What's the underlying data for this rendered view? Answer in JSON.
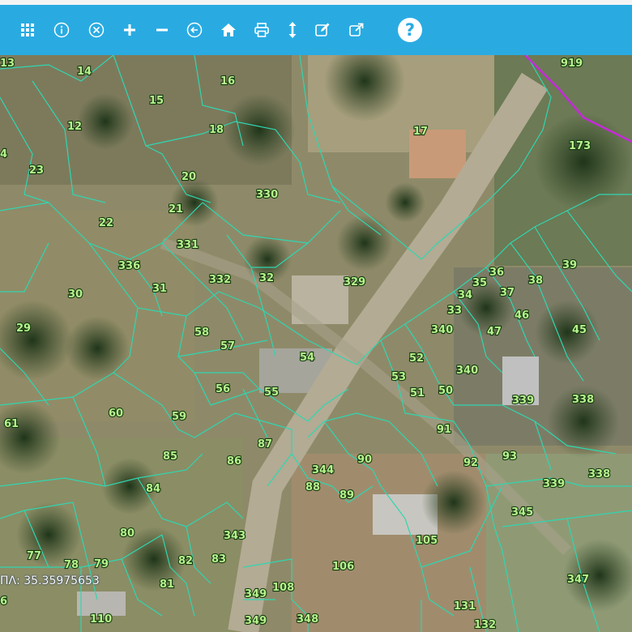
{
  "toolbar": {
    "buttons": [
      {
        "name": "grid-menu-button",
        "icon": "grid-icon"
      },
      {
        "name": "info-button",
        "icon": "info-icon"
      },
      {
        "name": "clear-button",
        "icon": "circle-close-icon"
      },
      {
        "name": "zoom-in-button",
        "icon": "plus-icon"
      },
      {
        "name": "zoom-out-button",
        "icon": "minus-icon"
      },
      {
        "name": "back-button",
        "icon": "circle-arrow-left-icon"
      },
      {
        "name": "home-button",
        "icon": "home-icon"
      },
      {
        "name": "print-button",
        "icon": "printer-icon"
      },
      {
        "name": "measure-button",
        "icon": "vertical-arrows-icon"
      },
      {
        "name": "edit-button",
        "icon": "edit-icon"
      },
      {
        "name": "open-external-button",
        "icon": "external-link-icon"
      },
      {
        "name": "help-button",
        "icon": "question-icon"
      }
    ],
    "color": "#29abe2"
  },
  "map": {
    "parcel_line_color": "#2fd6b0",
    "boundary_color": "#c42bd8",
    "label_color": "#b7f28d",
    "parcels": [
      {
        "label": "13"
      },
      {
        "label": "14"
      },
      {
        "label": "16"
      },
      {
        "label": "15"
      },
      {
        "label": "12"
      },
      {
        "label": "18"
      },
      {
        "label": "17"
      },
      {
        "label": "919"
      },
      {
        "label": "173"
      },
      {
        "label": "4"
      },
      {
        "label": "23"
      },
      {
        "label": "20"
      },
      {
        "label": "330"
      },
      {
        "label": "21"
      },
      {
        "label": "22"
      },
      {
        "label": "331"
      },
      {
        "label": "336"
      },
      {
        "label": "332"
      },
      {
        "label": "32"
      },
      {
        "label": "329"
      },
      {
        "label": "31"
      },
      {
        "label": "30"
      },
      {
        "label": "36"
      },
      {
        "label": "39"
      },
      {
        "label": "35"
      },
      {
        "label": "38"
      },
      {
        "label": "34"
      },
      {
        "label": "37"
      },
      {
        "label": "33"
      },
      {
        "label": "46"
      },
      {
        "label": "29"
      },
      {
        "label": "58"
      },
      {
        "label": "340"
      },
      {
        "label": "47"
      },
      {
        "label": "45"
      },
      {
        "label": "57"
      },
      {
        "label": "54"
      },
      {
        "label": "52"
      },
      {
        "label": "340"
      },
      {
        "label": "53"
      },
      {
        "label": "56"
      },
      {
        "label": "55"
      },
      {
        "label": "51"
      },
      {
        "label": "50"
      },
      {
        "label": "339"
      },
      {
        "label": "338"
      },
      {
        "label": "60"
      },
      {
        "label": "59"
      },
      {
        "label": "61"
      },
      {
        "label": "91"
      },
      {
        "label": "87"
      },
      {
        "label": "85"
      },
      {
        "label": "86"
      },
      {
        "label": "90"
      },
      {
        "label": "93"
      },
      {
        "label": "92"
      },
      {
        "label": "344"
      },
      {
        "label": "338"
      },
      {
        "label": "84"
      },
      {
        "label": "88"
      },
      {
        "label": "89"
      },
      {
        "label": "339"
      },
      {
        "label": "345"
      },
      {
        "label": "80"
      },
      {
        "label": "343"
      },
      {
        "label": "105"
      },
      {
        "label": "77"
      },
      {
        "label": "78"
      },
      {
        "label": "79"
      },
      {
        "label": "82"
      },
      {
        "label": "83"
      },
      {
        "label": "106"
      },
      {
        "label": "347"
      },
      {
        "label": "81"
      },
      {
        "label": "108"
      },
      {
        "label": "349"
      },
      {
        "label": "131"
      },
      {
        "label": "6"
      },
      {
        "label": "110"
      },
      {
        "label": "349"
      },
      {
        "label": "348"
      },
      {
        "label": "132"
      }
    ]
  },
  "coordinate_readout": "ΠΛ: 35.35975653"
}
